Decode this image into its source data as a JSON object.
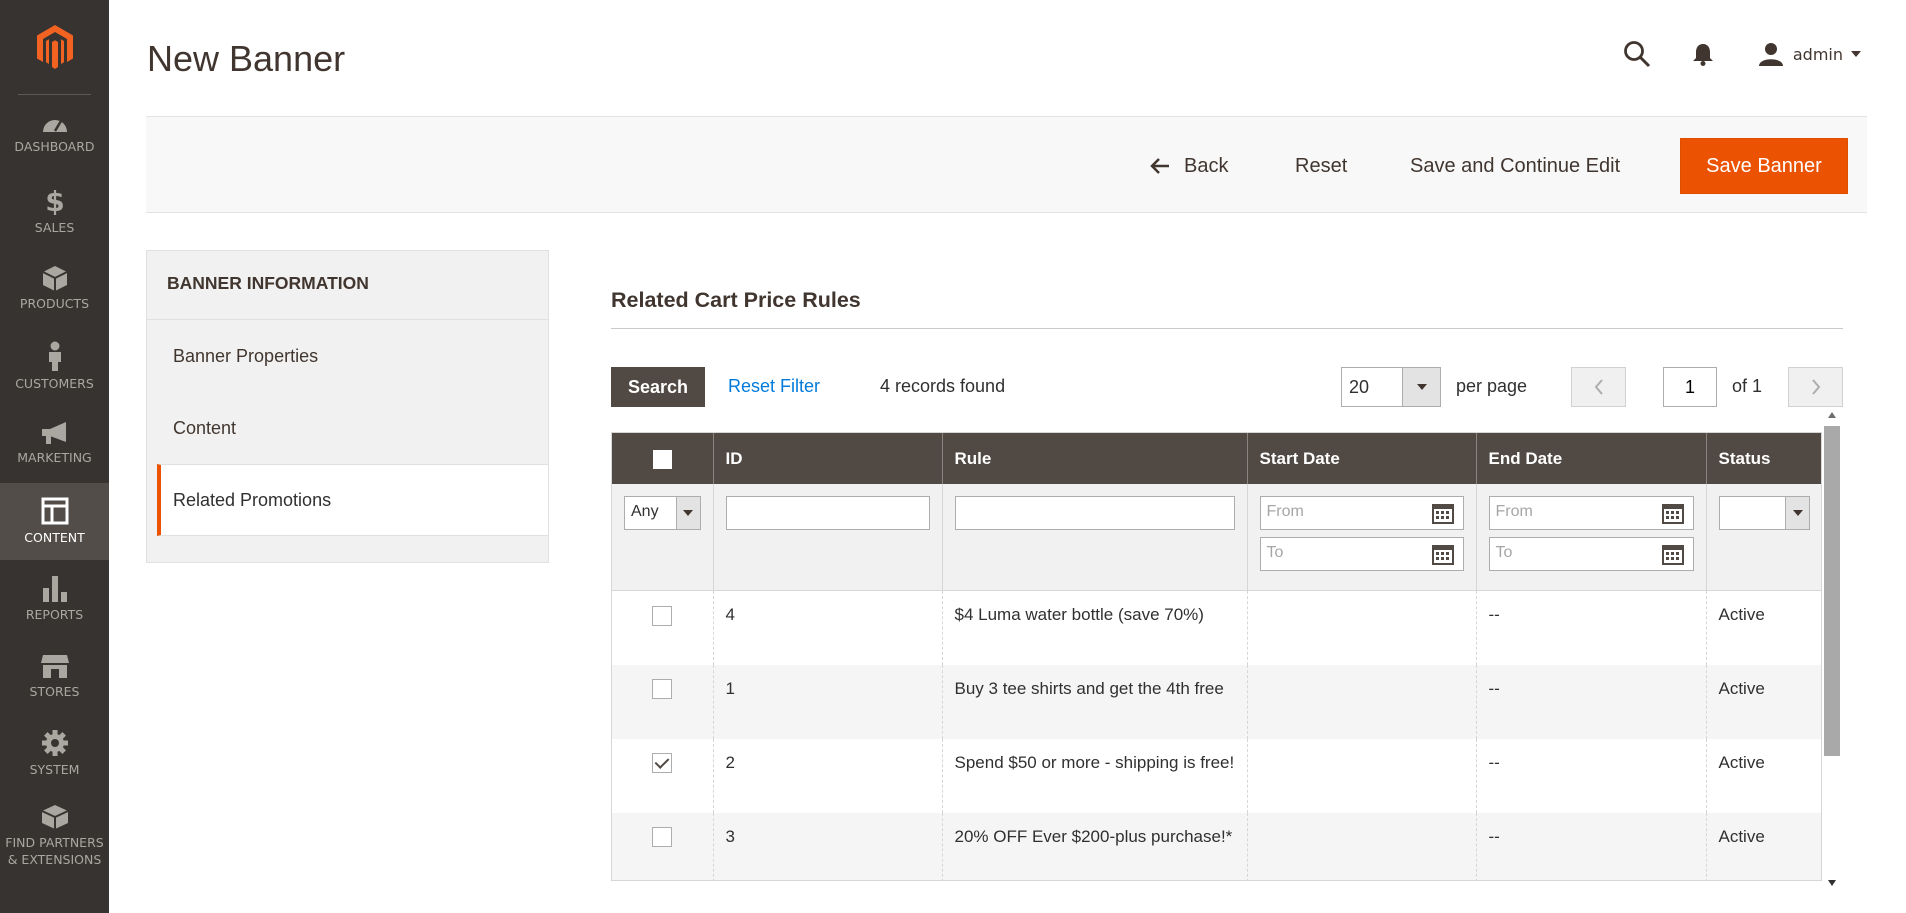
{
  "sidebar": {
    "items": [
      {
        "label": "DASHBOARD",
        "icon": "dashboard-icon"
      },
      {
        "label": "SALES",
        "icon": "dollar-icon"
      },
      {
        "label": "PRODUCTS",
        "icon": "box-icon"
      },
      {
        "label": "CUSTOMERS",
        "icon": "person-icon"
      },
      {
        "label": "MARKETING",
        "icon": "megaphone-icon"
      },
      {
        "label": "CONTENT",
        "icon": "layout-icon",
        "active": true
      },
      {
        "label": "REPORTS",
        "icon": "bar-chart-icon"
      },
      {
        "label": "STORES",
        "icon": "store-icon"
      },
      {
        "label": "SYSTEM",
        "icon": "gear-icon"
      },
      {
        "label": "FIND PARTNERS & EXTENSIONS",
        "icon": "blocks-icon"
      }
    ]
  },
  "header": {
    "title": "New Banner",
    "user": "admin"
  },
  "actions": {
    "back": "Back",
    "reset": "Reset",
    "save_continue": "Save and Continue Edit",
    "save_banner": "Save Banner"
  },
  "tabs": {
    "title": "BANNER INFORMATION",
    "items": [
      "Banner Properties",
      "Content",
      "Related Promotions"
    ]
  },
  "section": {
    "title": "Related Cart Price Rules"
  },
  "grid_controls": {
    "search": "Search",
    "reset_filter": "Reset Filter",
    "records": "4 records found",
    "per_page_value": "20",
    "per_page_label": "per page",
    "page": "1",
    "of": "of 1"
  },
  "grid": {
    "columns": [
      "ID",
      "Rule",
      "Start Date",
      "End Date",
      "Status"
    ],
    "filters": {
      "any": "Any",
      "from": "From",
      "to": "To"
    },
    "rows": [
      {
        "checked": false,
        "id": "4",
        "rule": "$4 Luma water bottle (save 70%)",
        "start": "",
        "end": "--",
        "status": "Active"
      },
      {
        "checked": false,
        "id": "1",
        "rule": "Buy 3 tee shirts and get the 4th free",
        "start": "",
        "end": "--",
        "status": "Active"
      },
      {
        "checked": true,
        "id": "2",
        "rule": "Spend $50 or more - shipping is free!",
        "start": "",
        "end": "--",
        "status": "Active"
      },
      {
        "checked": false,
        "id": "3",
        "rule": "20% OFF Ever $200-plus purchase!*",
        "start": "",
        "end": "--",
        "status": "Active"
      }
    ]
  },
  "colors": {
    "accent": "#eb5202",
    "sidebar_bg": "#373330",
    "grid_header_bg": "#514943",
    "link": "#007bdb"
  }
}
